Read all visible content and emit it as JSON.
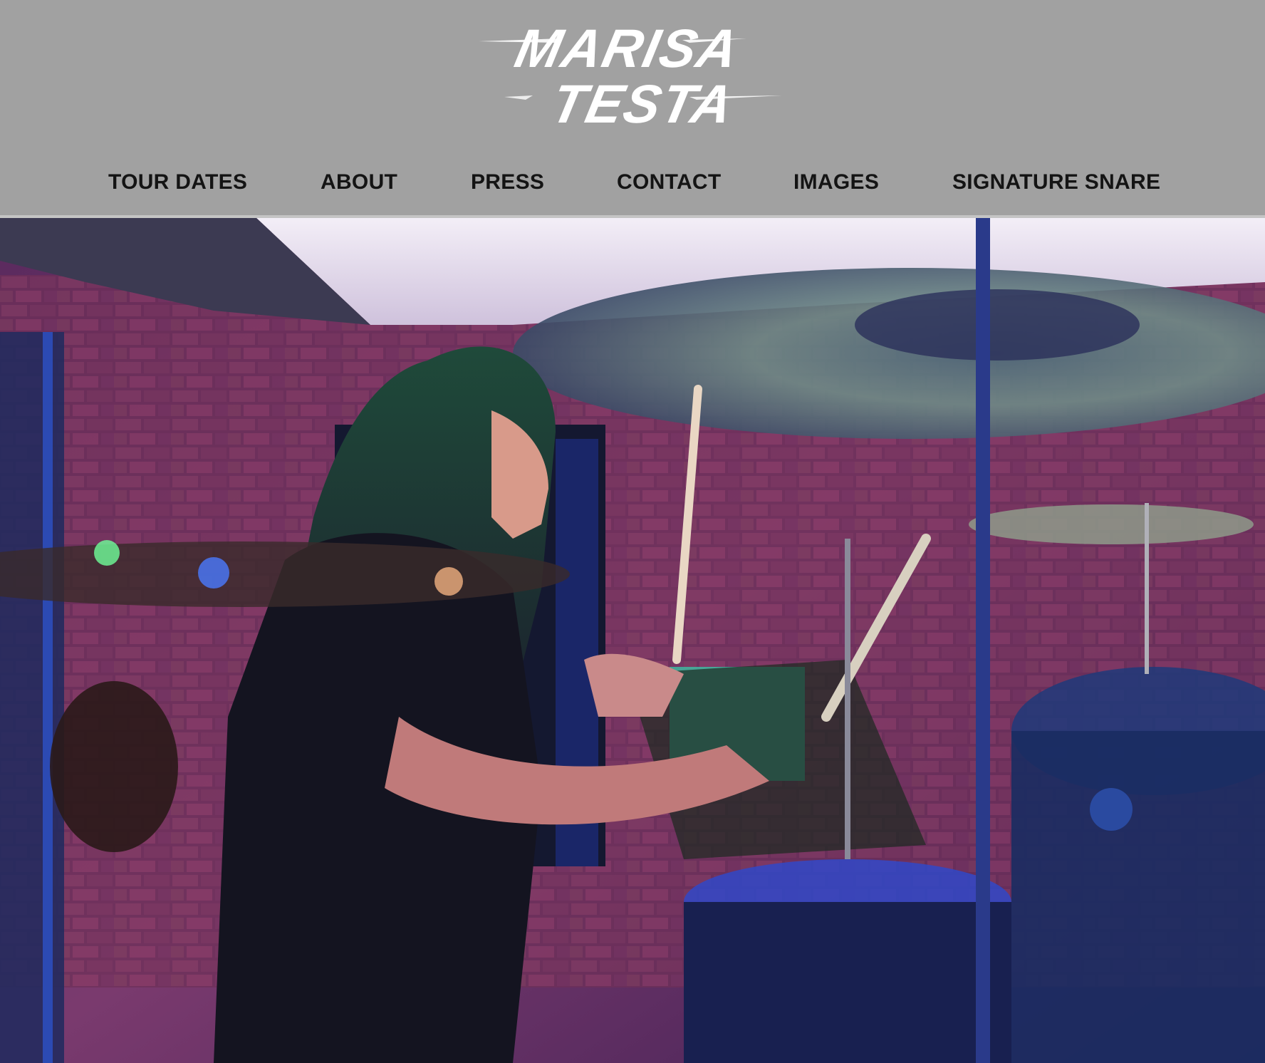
{
  "logo": {
    "line1": "MARISA",
    "line2": "TESTA"
  },
  "nav": {
    "items": [
      {
        "label": "TOUR DATES"
      },
      {
        "label": "ABOUT"
      },
      {
        "label": "PRESS"
      },
      {
        "label": "CONTACT"
      },
      {
        "label": "IMAGES"
      },
      {
        "label": "SIGNATURE SNARE"
      }
    ]
  },
  "colors": {
    "header_bg": "#a1a1a1",
    "nav_text": "#141414",
    "logo": "#ffffff"
  },
  "hero": {
    "icon": "drummer-photo"
  }
}
